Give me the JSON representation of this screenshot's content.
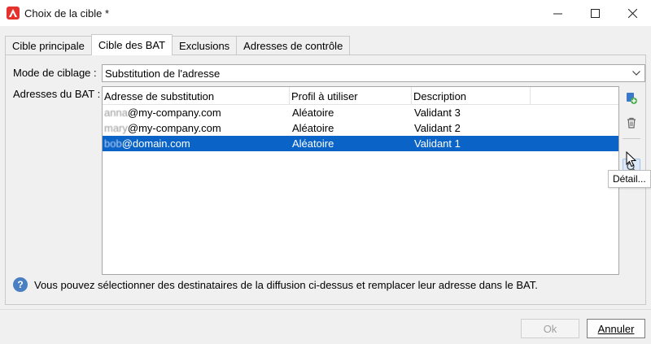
{
  "window": {
    "title": "Choix de la cible *"
  },
  "tabs": [
    {
      "label": "Cible principale"
    },
    {
      "label": "Cible des BAT"
    },
    {
      "label": "Exclusions"
    },
    {
      "label": "Adresses de contrôle"
    }
  ],
  "form": {
    "mode_label": "Mode de ciblage :",
    "mode_value": "Substitution de l'adresse",
    "addresses_label": "Adresses du BAT :"
  },
  "table": {
    "headers": [
      "Adresse de substitution",
      "Profil à utiliser",
      "Description"
    ],
    "rows": [
      {
        "address_prefix": "anna",
        "address_domain": "@my-company.com",
        "profile": "Aléatoire",
        "description": "Validant 3"
      },
      {
        "address_prefix": "mary",
        "address_domain": "@my-company.com",
        "profile": "Aléatoire",
        "description": "Validant 2"
      },
      {
        "address_prefix": "bob",
        "address_domain": "@domain.com",
        "profile": "Aléatoire",
        "description": "Validant 1"
      }
    ],
    "selected_row": 2
  },
  "tooltip": "Détail...",
  "info_text": "Vous pouvez sélectionner des destinataires de la diffusion ci-dessus et remplacer leur adresse dans le BAT.",
  "buttons": {
    "ok_label": "Ok",
    "cancel_label": "Annuler"
  },
  "colors": {
    "accent": "#0a64c8",
    "app_icon": "#e5322d"
  }
}
